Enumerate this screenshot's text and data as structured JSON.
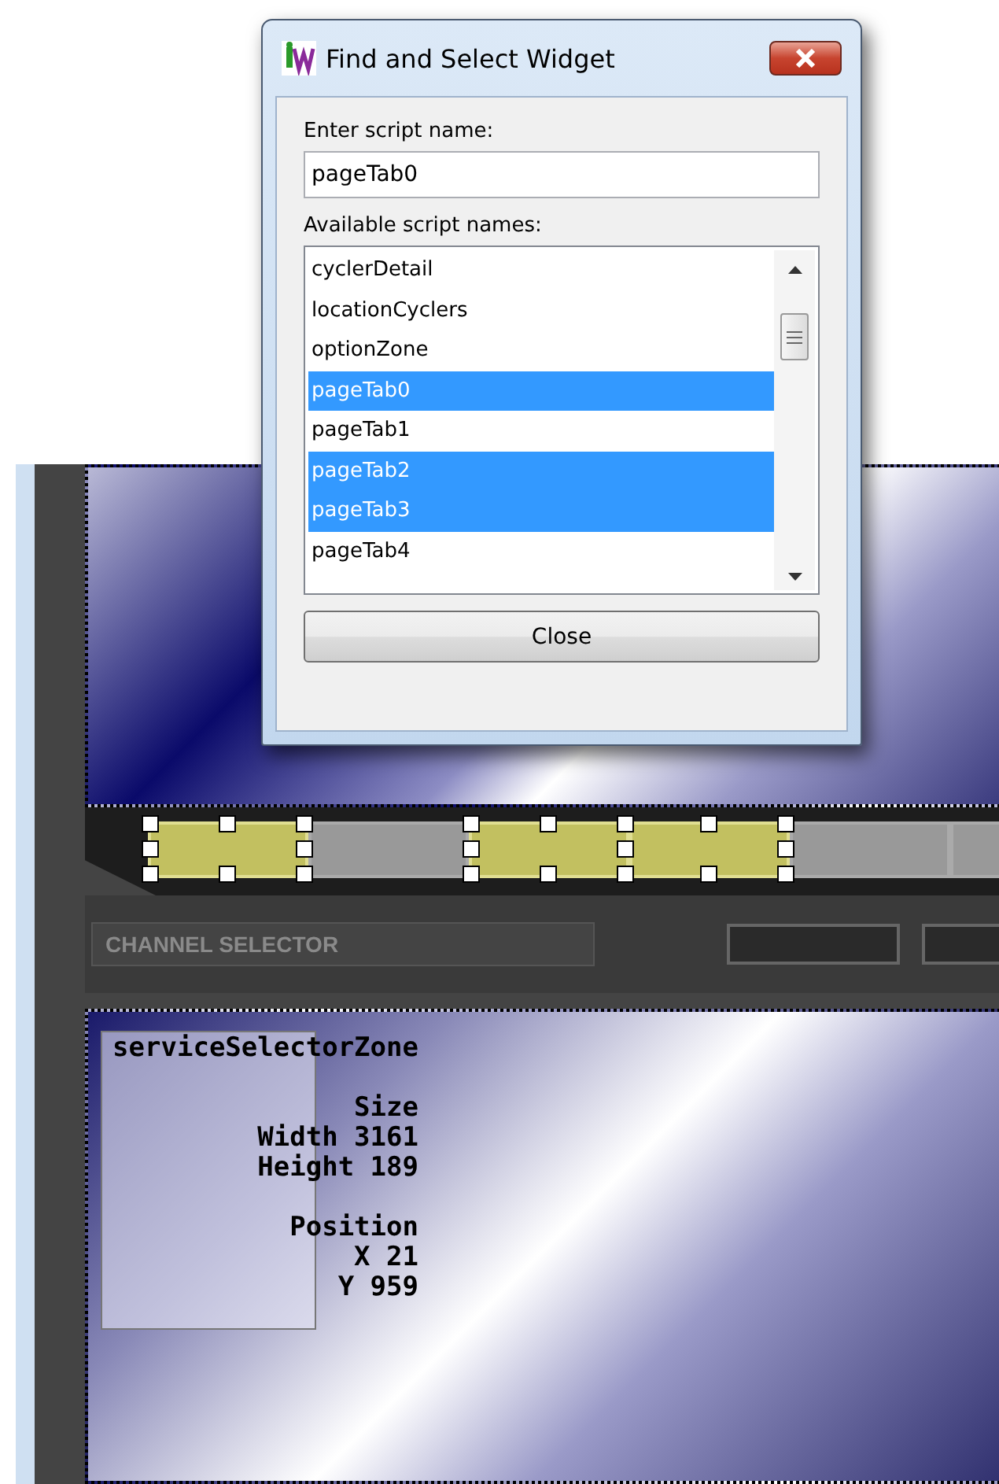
{
  "dialog": {
    "title": "Find and Select Widget",
    "name_label": "Enter script name:",
    "name_value": "pageTab0",
    "list_label": "Available script names:",
    "items": [
      {
        "label": "cyclerDetail",
        "selected": false
      },
      {
        "label": "locationCyclers",
        "selected": false
      },
      {
        "label": "optionZone",
        "selected": false
      },
      {
        "label": "pageTab0",
        "selected": true
      },
      {
        "label": "pageTab1",
        "selected": false
      },
      {
        "label": "pageTab2",
        "selected": true
      },
      {
        "label": "pageTab3",
        "selected": true
      },
      {
        "label": "pageTab4",
        "selected": false
      }
    ],
    "close_button": "Close"
  },
  "canvas": {
    "page_tabs": [
      {
        "selected": true
      },
      {
        "selected": false
      },
      {
        "selected": true
      },
      {
        "selected": true
      },
      {
        "selected": false
      },
      {
        "selected": false
      }
    ],
    "channel_selector": "CHANNEL SELECTOR",
    "zone_info": {
      "name": "serviceSelectorZone",
      "size_heading": "Size",
      "width": "Width 3161",
      "height": "Height 189",
      "position_heading": "Position",
      "x": "X 21",
      "y": "Y 959"
    }
  }
}
